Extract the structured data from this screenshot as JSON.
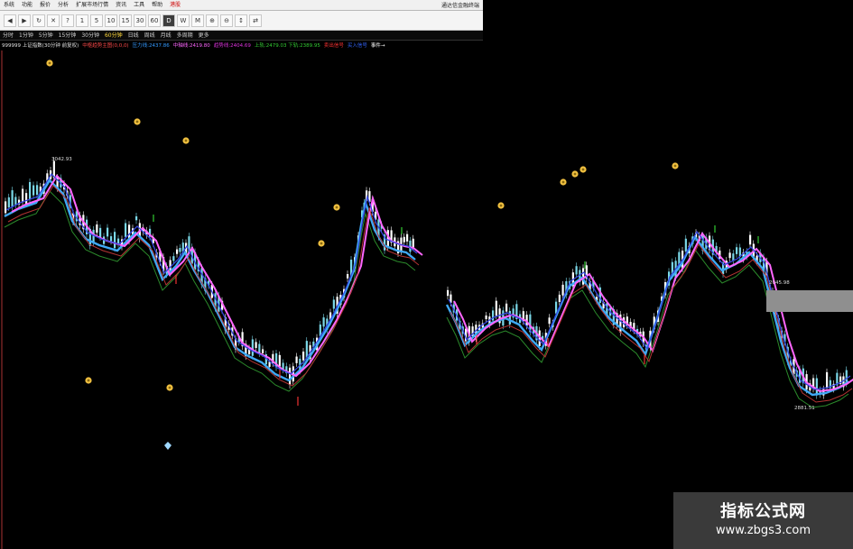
{
  "menubar": {
    "items": [
      "系统",
      "功能",
      "报价",
      "分析",
      "扩展市场行情",
      "资讯",
      "工具",
      "帮助"
    ],
    "active_index": 7,
    "active_label": "港股",
    "right_title": "通达信金融终端"
  },
  "toolbar": {
    "buttons": [
      "◀",
      "▶",
      "↻",
      "✕",
      "?",
      "1",
      "5",
      "10",
      "15",
      "30",
      "60",
      "D",
      "W",
      "M",
      "⊕",
      "⊖",
      "↕",
      "⇄"
    ]
  },
  "period_bar": {
    "items": [
      "分时",
      "1分钟",
      "5分钟",
      "15分钟",
      "30分钟",
      "60分钟",
      "日线",
      "周线",
      "月线",
      "多周期",
      "更多"
    ],
    "active_index": 5
  },
  "legend": {
    "items": [
      {
        "text": "999999 上证指数(30分钟 前复权)",
        "color": "#e0e0e0"
      },
      {
        "text": "中枢趋势主图(0,0,0)",
        "color": "#ff4a4a"
      },
      {
        "text": "压力线:2437.86",
        "color": "#3399ff"
      },
      {
        "text": "中轴线:2419.80",
        "color": "#ff66ff"
      },
      {
        "text": "趋势线:2404.69",
        "color": "#dd33dd"
      },
      {
        "text": "上轨:2479.03 下轨:2389.95",
        "color": "#33cc33"
      },
      {
        "text": "卖出信号",
        "color": "#ff3333"
      },
      {
        "text": "买入信号",
        "color": "#3366ff"
      },
      {
        "text": "事件→",
        "color": "#ffffff"
      }
    ]
  },
  "chart_data": {
    "type": "line",
    "y_label_high": "3042.93",
    "y_label_box": "2045.98",
    "y_label_low": "2881.51",
    "colors": {
      "up": "#7ad8e8",
      "down": "#ffffff",
      "pressure": "#3fa9f5",
      "axis_mid": "#ff66ff",
      "trend": "#b33fb3",
      "band_up": "#2b8a2b",
      "red_line": "#b33333",
      "blue_line": "#3344dd"
    }
  },
  "watermark": {
    "title": "指标公式网",
    "url": "www.zbgs3.com"
  }
}
